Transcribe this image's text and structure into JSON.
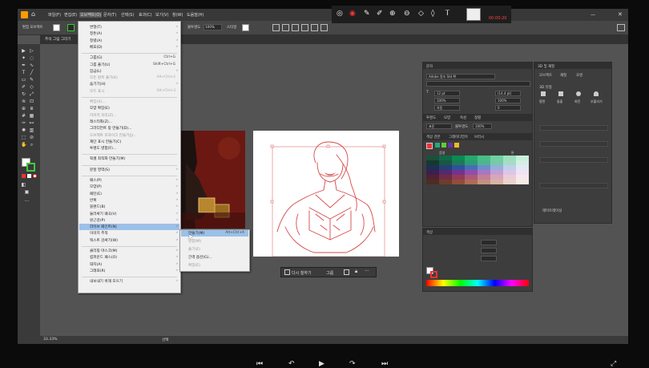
{
  "menubar": {
    "items": [
      "파일(F)",
      "편집(E)",
      "오브젝트(O)",
      "문자(T)",
      "선택(S)",
      "효과(C)",
      "보기(V)",
      "창(W)",
      "도움말(H)"
    ]
  },
  "annotation_toolbar": {
    "time": "00:00:20",
    "icons": [
      "circle-icon",
      "record-icon",
      "pen-icon",
      "zoom-in-icon",
      "zoom-out-icon",
      "tag-icon",
      "eraser-icon",
      "text-icon",
      "thumbnail-icon",
      "screen-icon",
      "document-icon",
      "chevron-icon"
    ]
  },
  "control_bar": {
    "label": "편집 오브젝트",
    "stroke_label": "불투명도",
    "opacity": "100%",
    "style_label": "스타일"
  },
  "tab": {
    "title": "추석 그림 그리기"
  },
  "object_menu": {
    "items": [
      {
        "label": "변형(T)",
        "arrow": true
      },
      {
        "label": "정돈(A)",
        "arrow": true
      },
      {
        "label": "정렬(A)",
        "arrow": true
      },
      {
        "label": "배포(D)",
        "arrow": true
      },
      {
        "sep": true
      },
      {
        "label": "그룹(G)",
        "shortcut": "Ctrl+G"
      },
      {
        "label": "그룹 풀기(U)",
        "shortcut": "Shift+Ctrl+G"
      },
      {
        "label": "잠금(L)",
        "arrow": true
      },
      {
        "label": "모든 항목 풀기(K)",
        "shortcut": "Alt+Ctrl+2",
        "disabled": true
      },
      {
        "label": "숨기기(H)",
        "arrow": true
      },
      {
        "label": "모두 표시",
        "shortcut": "Alt+Ctrl+3",
        "disabled": true
      },
      {
        "sep": true
      },
      {
        "label": "확장(X)...",
        "disabled": true
      },
      {
        "label": "모양 확장(E)"
      },
      {
        "label": "이미지 처리(Z)...",
        "disabled": true
      },
      {
        "label": "래스터화(Z)..."
      },
      {
        "label": "그라디언트 망 만들기(D)..."
      },
      {
        "label": "오브젝트 모자이크 만들기(J)...",
        "disabled": true
      },
      {
        "label": "재단 표시 만들기(C)"
      },
      {
        "label": "투명도 병합(F)..."
      },
      {
        "sep": true
      },
      {
        "label": "픽셀 최적화 만들기(M)"
      },
      {
        "sep": true
      },
      {
        "label": "분할 영역(S)",
        "arrow": true
      },
      {
        "sep": true
      },
      {
        "label": "패스(P)",
        "arrow": true
      },
      {
        "label": "모양(P)",
        "arrow": true
      },
      {
        "label": "패턴(E)",
        "arrow": true
      },
      {
        "label": "반복",
        "arrow": true
      },
      {
        "label": "블렌드(B)",
        "arrow": true
      },
      {
        "label": "둘러싸기 왜곡(V)",
        "arrow": true
      },
      {
        "label": "원근감(P)",
        "arrow": true
      },
      {
        "label": "라이브 페인트(N)",
        "arrow": true,
        "highlight": true
      },
      {
        "label": "이미지 추적",
        "arrow": true
      },
      {
        "label": "텍스트 감싸기(W)",
        "arrow": true
      },
      {
        "sep": true
      },
      {
        "label": "클리핑 마스크(M)",
        "arrow": true
      },
      {
        "label": "컴파운드 패스(O)",
        "arrow": true
      },
      {
        "label": "대지(A)",
        "arrow": true
      },
      {
        "label": "그래프(R)",
        "arrow": true
      },
      {
        "sep": true
      },
      {
        "label": "내보내기 위해 모으기",
        "arrow": true
      }
    ]
  },
  "submenu": {
    "items": [
      {
        "label": "만들기(M)",
        "shortcut": "Alt+Ctrl+X",
        "highlight": true
      },
      {
        "label": "병합(M)",
        "disabled": true
      },
      {
        "label": "풀기(E)",
        "disabled": true
      },
      {
        "label": "간격 옵션(G)..."
      },
      {
        "label": "확장(E)",
        "disabled": true
      }
    ]
  },
  "context_bar": {
    "label": "다시 칠하기",
    "group": "그룹"
  },
  "char_panel": {
    "title": "문자",
    "font": "Adobe 명조 Std M",
    "size": "12 pt",
    "leading": "(14.4 pt)",
    "scale_v": "100%",
    "scale_h": "100%",
    "tracking": "0",
    "kerning": "자동",
    "tabs2": [
      "투명도",
      "모양",
      "속성",
      "정렬"
    ],
    "blend": "표준",
    "opacity_label": "불투명도",
    "opacity": "100%",
    "swatch_tabs": [
      "색상 견본",
      "그레이디언트",
      "브러시"
    ],
    "swatch_header": [
      "음영",
      "",
      "",
      "",
      "",
      "",
      "톤"
    ],
    "color_title": "색상",
    "color_tab": "색상 안내"
  },
  "swatch_colors": [
    [
      "#1d4f3a",
      "#0e6a45",
      "#0a8a56",
      "#24a86e",
      "#48bf86",
      "#6fd1a1",
      "#9ee0c0",
      "#c8eedc"
    ],
    [
      "#143a30",
      "#1a5742",
      "#1d7a58",
      "#2c9c73",
      "#4fb590",
      "#78c9a9",
      "#a6dcc5",
      "#d4efe3"
    ],
    [
      "#1e2e54",
      "#263e78",
      "#30519c",
      "#4a6cb8",
      "#6f8ccc",
      "#98aedd",
      "#c0cfeb",
      "#e2e9f6"
    ],
    [
      "#3d1f4c",
      "#56296d",
      "#733290",
      "#8f4eab",
      "#a976c0",
      "#c39ed5",
      "#dcc6e7",
      "#efe3f4"
    ],
    [
      "#4e2233",
      "#6e2d45",
      "#923a5a",
      "#ae5878",
      "#c47f98",
      "#d8a6b8",
      "#eaccd8",
      "#f6e8ee"
    ],
    [
      "#4e2c23",
      "#6e3c2e",
      "#924e3a",
      "#ae6d57",
      "#c4917f",
      "#d8b4a6",
      "#ead4cc",
      "#f6ece8"
    ]
  ],
  "right_panel": {
    "tabs": [
      "3D 및 재질",
      "오브젝트",
      "재질",
      "조명"
    ],
    "section": "3D 유형",
    "types": [
      "평면",
      "돌출",
      "회전",
      "부풀리기"
    ],
    "footer": "레이트레이싱"
  },
  "status_bar": {
    "zoom": "33.33%",
    "mode": "선택"
  },
  "player": {
    "icons": [
      "prev-icon",
      "rewind-icon",
      "play-icon",
      "forward-icon",
      "next-icon",
      "fullscreen-icon"
    ]
  }
}
